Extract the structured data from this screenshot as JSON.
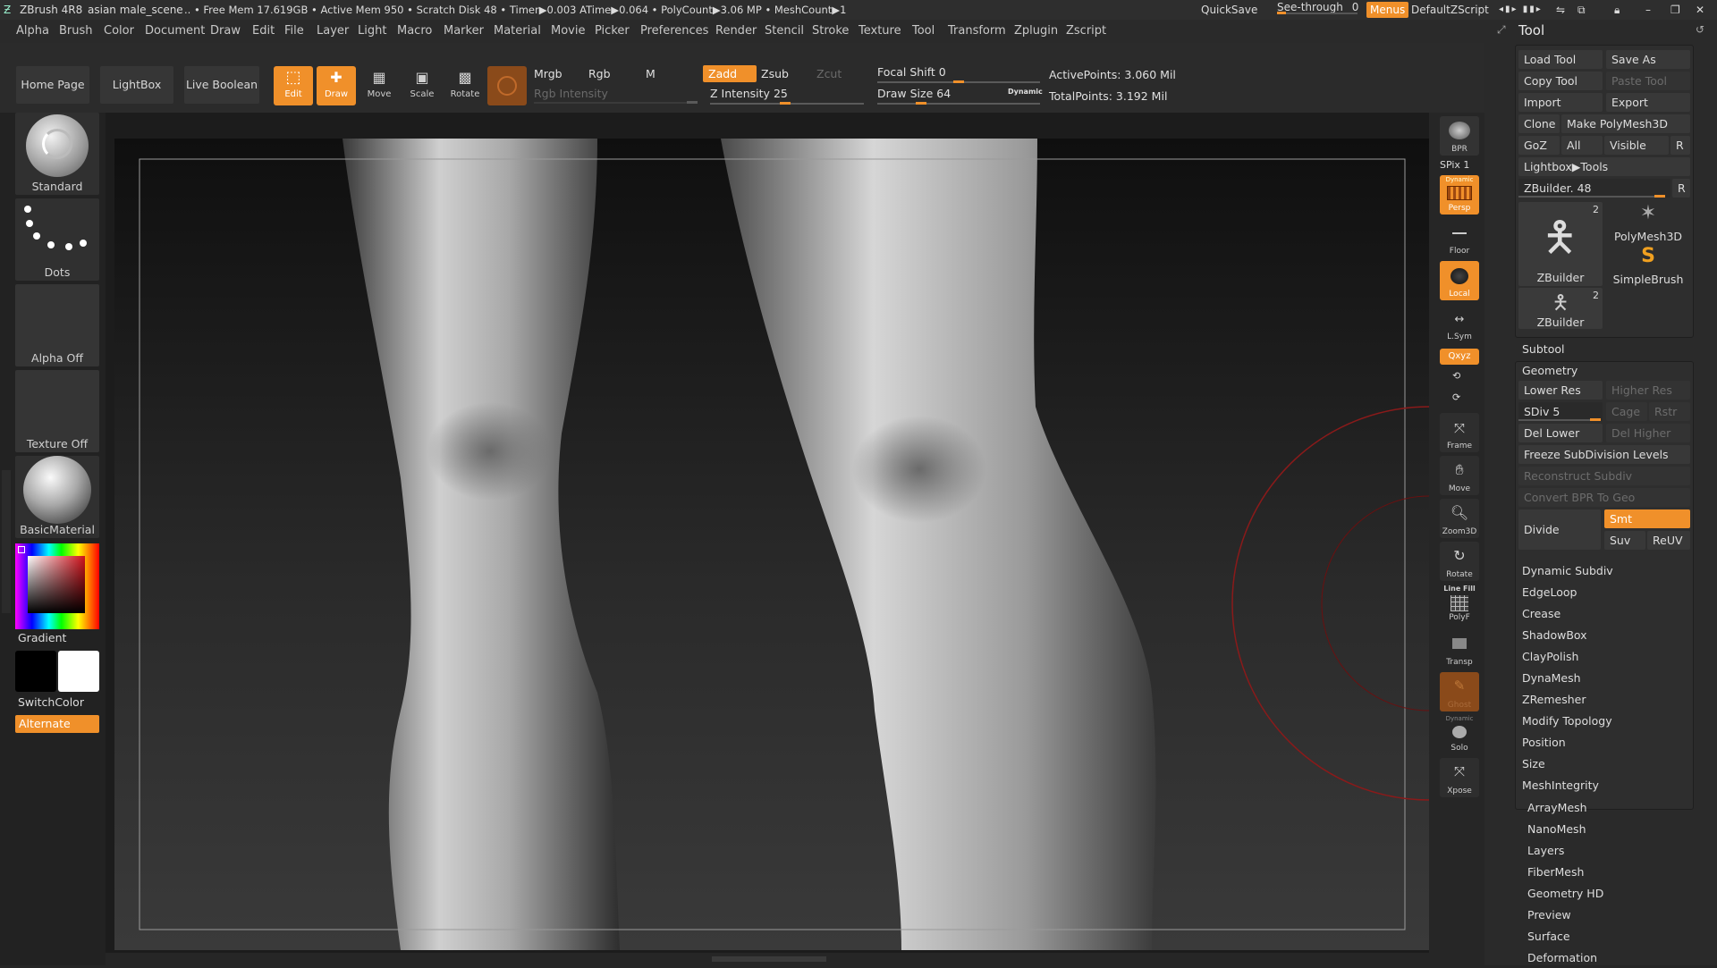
{
  "titlebar": {
    "app": "ZBrush 4R8",
    "scene": "asian male_scene",
    "stats": ".. • Free Mem 17.619GB • Active Mem 950 • Scratch Disk 48 •  Timer▶0.003 ATime▶0.064 • PolyCount▶3.06 MP  • MeshCount▶1",
    "quicksave": "QuickSave",
    "see_through": "See-through",
    "see_through_value": "0",
    "menus": "Menus",
    "script": "DefaultZScript"
  },
  "menu": [
    "Alpha",
    "Brush",
    "Color",
    "Document",
    "Draw",
    "Edit",
    "File",
    "Layer",
    "Light",
    "Macro",
    "Marker",
    "Material",
    "Movie",
    "Picker",
    "Preferences",
    "Render",
    "Stencil",
    "Stroke",
    "Texture",
    "Tool",
    "Transform",
    "Zplugin",
    "Zscript"
  ],
  "toolbar": {
    "home_page": "Home Page",
    "lightbox": "LightBox",
    "live_boolean": "Live Boolean",
    "edit": "Edit",
    "draw": "Draw",
    "move": "Move",
    "scale": "Scale",
    "rotate": "Rotate",
    "mrgb": "Mrgb",
    "rgb": "Rgb",
    "m": "M",
    "rgb_intensity": "Rgb Intensity",
    "zadd": "Zadd",
    "zsub": "Zsub",
    "zcut": "Zcut",
    "z_intensity_label": "Z Intensity",
    "z_intensity": "25",
    "focal_shift_label": "Focal Shift",
    "focal_shift": "0",
    "draw_size_label": "Draw Size",
    "draw_size": "64",
    "dynamic": "Dynamic",
    "active_points": "ActivePoints: 3.060 Mil",
    "total_points": "TotalPoints: 3.192 Mil"
  },
  "left_tray": {
    "brush": "Standard",
    "stroke": "Dots",
    "alpha": "Alpha Off",
    "texture": "Texture Off",
    "material": "BasicMaterial",
    "gradient": "Gradient",
    "switch_color": "SwitchColor",
    "alternate": "Alternate"
  },
  "shelf": {
    "bpr": "BPR",
    "spix": "SPix 1",
    "persp": "Persp",
    "dynamic_top": "Dynamic",
    "floor": "Floor",
    "local": "Local",
    "lsym": "L.Sym",
    "xyz": "Qxyz",
    "frame": "Frame",
    "move": "Move",
    "zoom": "Zoom3D",
    "rotate": "Rotate",
    "line_fill": "Line Fill",
    "polyf": "PolyF",
    "transp": "Transp",
    "ghost": "Ghost",
    "dynamic_solo": "Dynamic",
    "solo": "Solo",
    "xpose": "Xpose"
  },
  "tool_panel": {
    "title": "Tool",
    "load_tool": "Load Tool",
    "save_as": "Save As",
    "copy_tool": "Copy Tool",
    "paste_tool": "Paste Tool",
    "import": "Import",
    "export": "Export",
    "clone": "Clone",
    "make_polymesh": "Make PolyMesh3D",
    "goz": "GoZ",
    "all": "All",
    "visible": "Visible",
    "r": "R",
    "lightbox_tools": "Lightbox▶Tools",
    "zbuilder_slider": "ZBuilder. 48",
    "thumb1": "ZBuilder",
    "thumb1_count": "2",
    "thumb2": "PolyMesh3D",
    "thumb3": "SimpleBrush",
    "thumb4": "ZBuilder",
    "thumb4_count": "2",
    "subtool": "Subtool",
    "geometry": "Geometry",
    "lower_res": "Lower Res",
    "higher_res": "Higher Res",
    "sdiv": "SDiv 5",
    "cage": "Cage",
    "rstr": "Rstr",
    "del_lower": "Del Lower",
    "del_higher": "Del Higher",
    "freeze": "Freeze SubDivision Levels",
    "reconstruct": "Reconstruct Subdiv",
    "convert_bpr": "Convert BPR To Geo",
    "divide": "Divide",
    "smt": "Smt",
    "suv": "Suv",
    "reuv": "ReUV",
    "geometry_items": [
      "Dynamic Subdiv",
      "EdgeLoop",
      "Crease",
      "ShadowBox",
      "ClayPolish",
      "DynaMesh",
      "ZRemesher",
      "Modify Topology",
      "Position",
      "Size",
      "MeshIntegrity"
    ],
    "sections": [
      "ArrayMesh",
      "NanoMesh",
      "Layers",
      "FiberMesh",
      "Geometry HD",
      "Preview",
      "Surface",
      "Deformation"
    ]
  },
  "colors": {
    "accent": "#f0902a",
    "panel": "#2a2a2a"
  }
}
